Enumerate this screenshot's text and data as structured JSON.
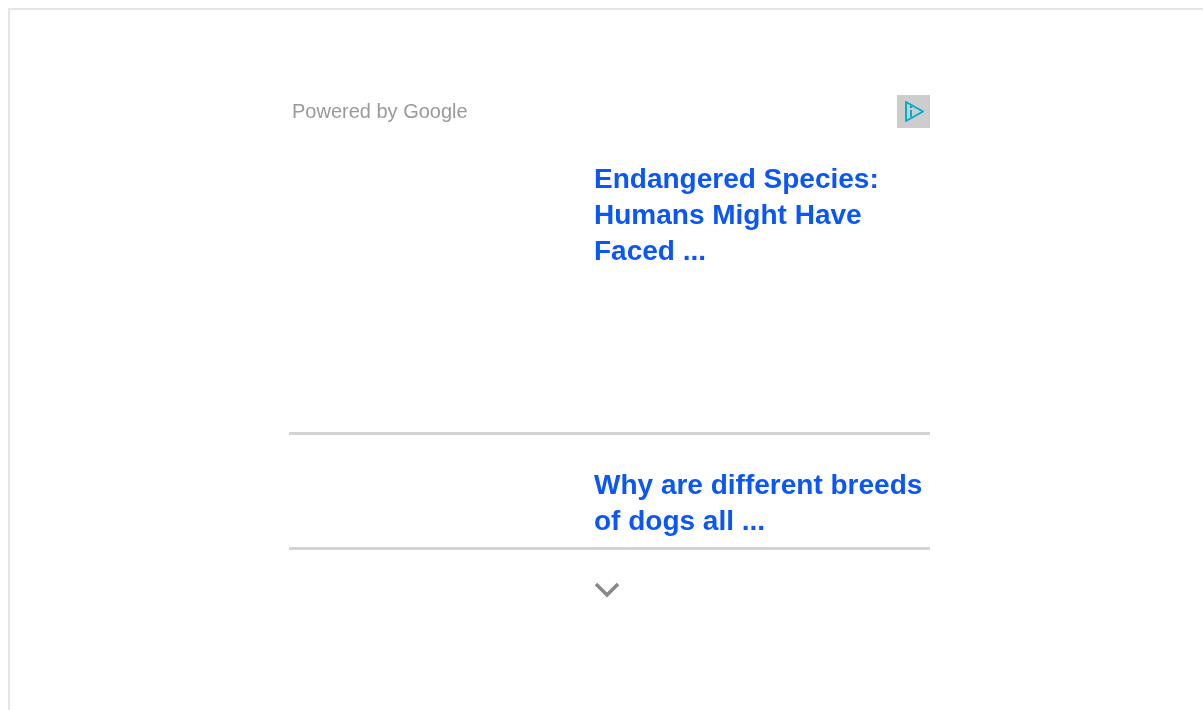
{
  "header": {
    "attribution": "Powered by Google"
  },
  "items": [
    {
      "title": "Endangered Species: Humans Might Have Faced ...",
      "kind": "tall"
    },
    {
      "title": "Why are different breeds of dogs all ...",
      "kind": "short"
    }
  ]
}
